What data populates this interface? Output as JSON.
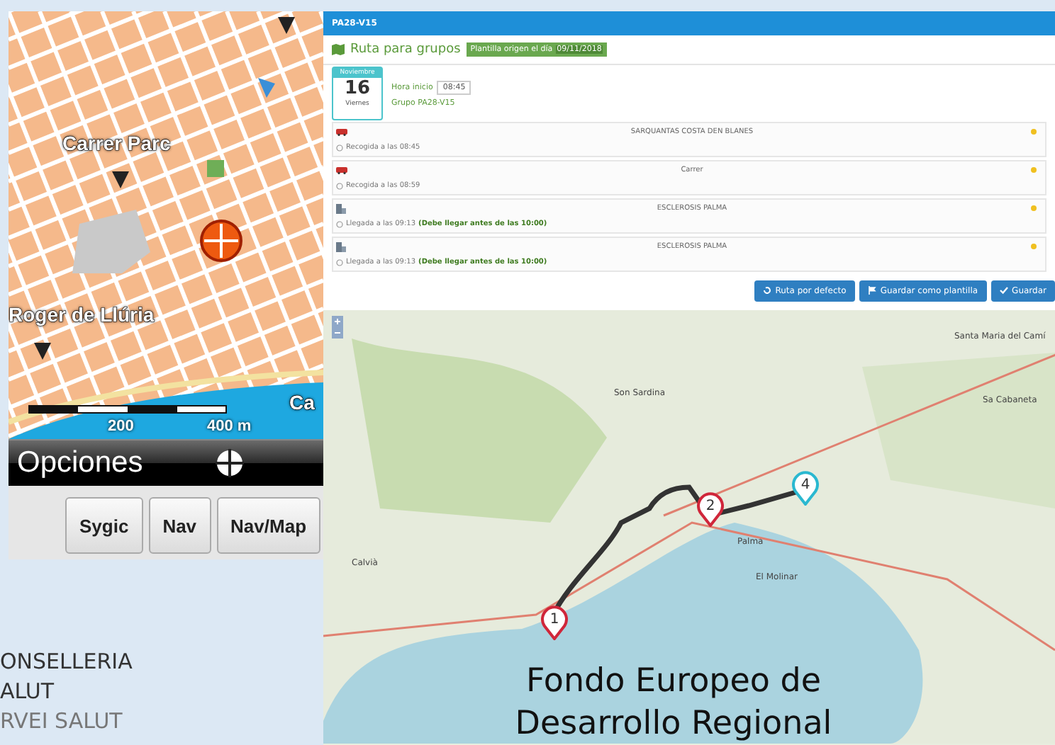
{
  "gps_screen": {
    "map_labels": [
      {
        "text": "Carrer Parc"
      },
      {
        "text": "Roger de Llúria"
      },
      {
        "text": "Ca"
      }
    ],
    "scale_labels": [
      "200",
      "400 m"
    ],
    "menu_label": "Opciones",
    "buttons": [
      "Sygic",
      "Nav",
      "Nav/Map"
    ]
  },
  "route_app": {
    "title": "PA28-V15",
    "heading": "Ruta para grupos",
    "template_badge": {
      "text": "Plantilla origen el día",
      "date": "09/11/2018"
    },
    "date_card": {
      "month": "Noviembre",
      "day": "16",
      "weekday": "Viernes"
    },
    "start_time_label": "Hora inicio",
    "start_time": "08:45",
    "group": "Grupo PA28-V15",
    "stops": [
      {
        "kind": "pickup",
        "name": "SARQUANTAS COSTA DEN BLANES",
        "time": "Recogida a las 08:45"
      },
      {
        "kind": "pickup",
        "name": "Carrer",
        "time": "Recogida a las 08:59"
      },
      {
        "kind": "destination",
        "name": "ESCLEROSIS PALMA",
        "time": "Llegada a las 09:13",
        "note": "(Debe llegar antes de las 10:00)"
      },
      {
        "kind": "destination",
        "name": "ESCLEROSIS PALMA",
        "time": "Llegada a las 09:13",
        "note": "(Debe llegar antes de las 10:00)"
      }
    ],
    "buttons": [
      {
        "kind": "reset",
        "label": "Ruta por defecto"
      },
      {
        "kind": "flag",
        "label": "Guardar como plantilla"
      },
      {
        "kind": "check",
        "label": "Guardar"
      }
    ],
    "map": {
      "labels": [
        {
          "text": "Santa Maria del Camí"
        },
        {
          "text": "Sa Cabaneta"
        },
        {
          "text": "Son Sardina"
        },
        {
          "text": "Palma"
        },
        {
          "text": "Calvià"
        },
        {
          "text": "El Molinar"
        }
      ],
      "markers": [
        {
          "number": "1",
          "color": "#d0263a"
        },
        {
          "number": "2",
          "color": "#d0263a"
        },
        {
          "number": "4",
          "color": "#2ab8d0"
        }
      ]
    }
  },
  "overlay_text": [
    "Fondo Europeo de",
    "Desarrollo Regional"
  ],
  "logo_lines": [
    "ONSELLERIA",
    "ALUT",
    "RVEI SALUT"
  ]
}
